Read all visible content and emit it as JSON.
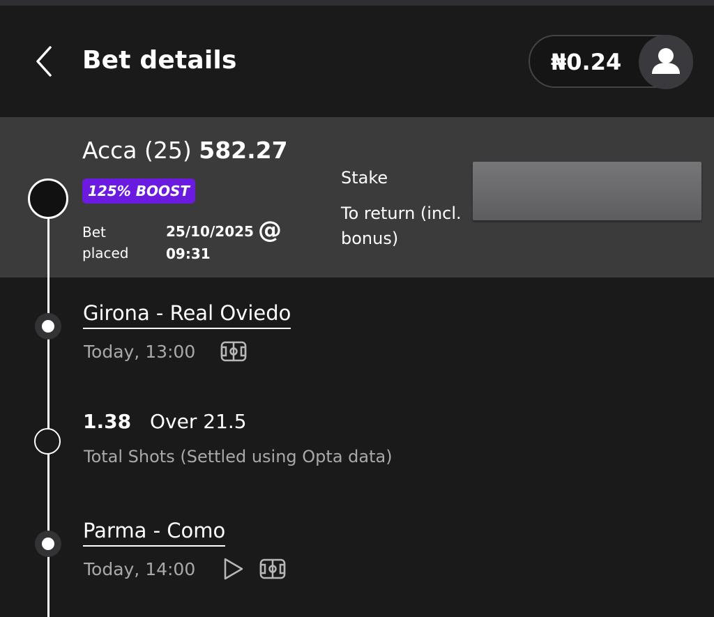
{
  "header": {
    "title": "Bet details",
    "balance": "₦0.24"
  },
  "summary": {
    "acca_label": "Acca (25)",
    "acca_odds": "582.27",
    "boost_badge": "125% BOOST",
    "bet_placed_label": "Bet placed",
    "bet_placed_value": "25/10/2025 09:31",
    "at_symbol": "@",
    "stake_label": "Stake",
    "to_return_label": "To return (incl. bonus)"
  },
  "legs": [
    {
      "match": "Girona - Real Oviedo",
      "time": "Today, 13:00",
      "icons": [
        "pitch-icon"
      ]
    },
    {
      "odds": "1.38",
      "selection": "Over 21.5",
      "market": "Total Shots (Settled using Opta data)"
    },
    {
      "match": "Parma - Como",
      "time": "Today, 14:00",
      "icons": [
        "play-icon",
        "pitch-icon"
      ]
    }
  ],
  "colors": {
    "background": "#1a1a1a",
    "summary_band": "#3b3b3c",
    "boost": "#6b1be0",
    "muted_text": "#a9a9a9"
  }
}
